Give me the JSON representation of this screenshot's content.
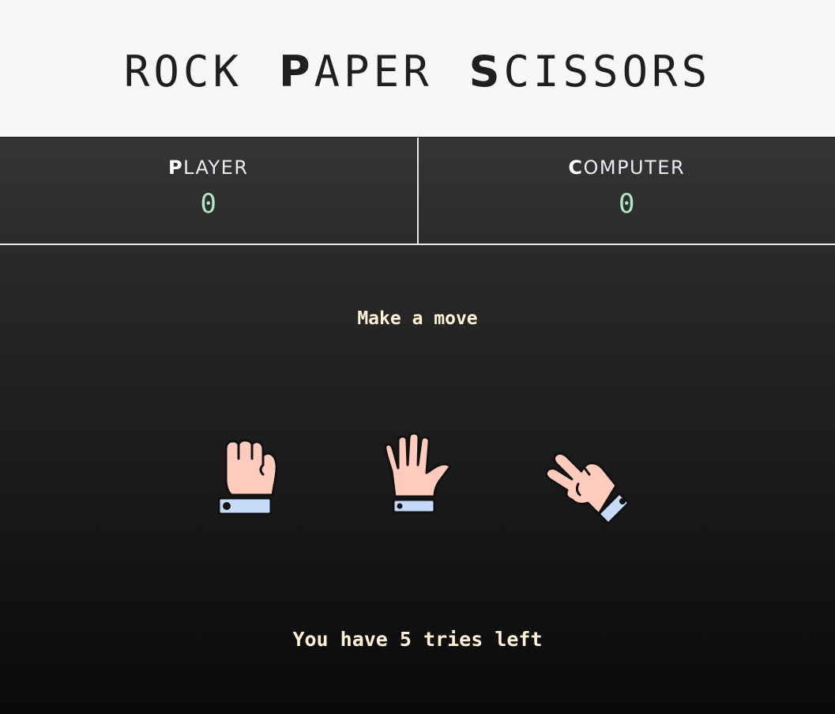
{
  "header": {
    "title_words": [
      {
        "cap": "R",
        "rest": "OCK"
      },
      {
        "cap": "P",
        "rest": "APER"
      },
      {
        "cap": "S",
        "rest": "CISSORS"
      }
    ]
  },
  "scoreboard": {
    "player": {
      "cap": "P",
      "rest": "LAYER",
      "score": "0"
    },
    "computer": {
      "cap": "C",
      "rest": "OMPUTER",
      "score": "0"
    }
  },
  "arena": {
    "prompt": "Make a move",
    "tries": "You have 5 tries left"
  },
  "moves": [
    {
      "name": "rock",
      "icon": "fist-hand-icon"
    },
    {
      "name": "paper",
      "icon": "open-hand-icon"
    },
    {
      "name": "scissors",
      "icon": "peace-hand-icon"
    }
  ],
  "colors": {
    "header_bg": "#f7f7f7",
    "score_text": "#aee8c8",
    "message_text": "#fff1d6",
    "skin": "#ffcbbd",
    "cuff": "#c8dafa",
    "outline": "#111111"
  }
}
